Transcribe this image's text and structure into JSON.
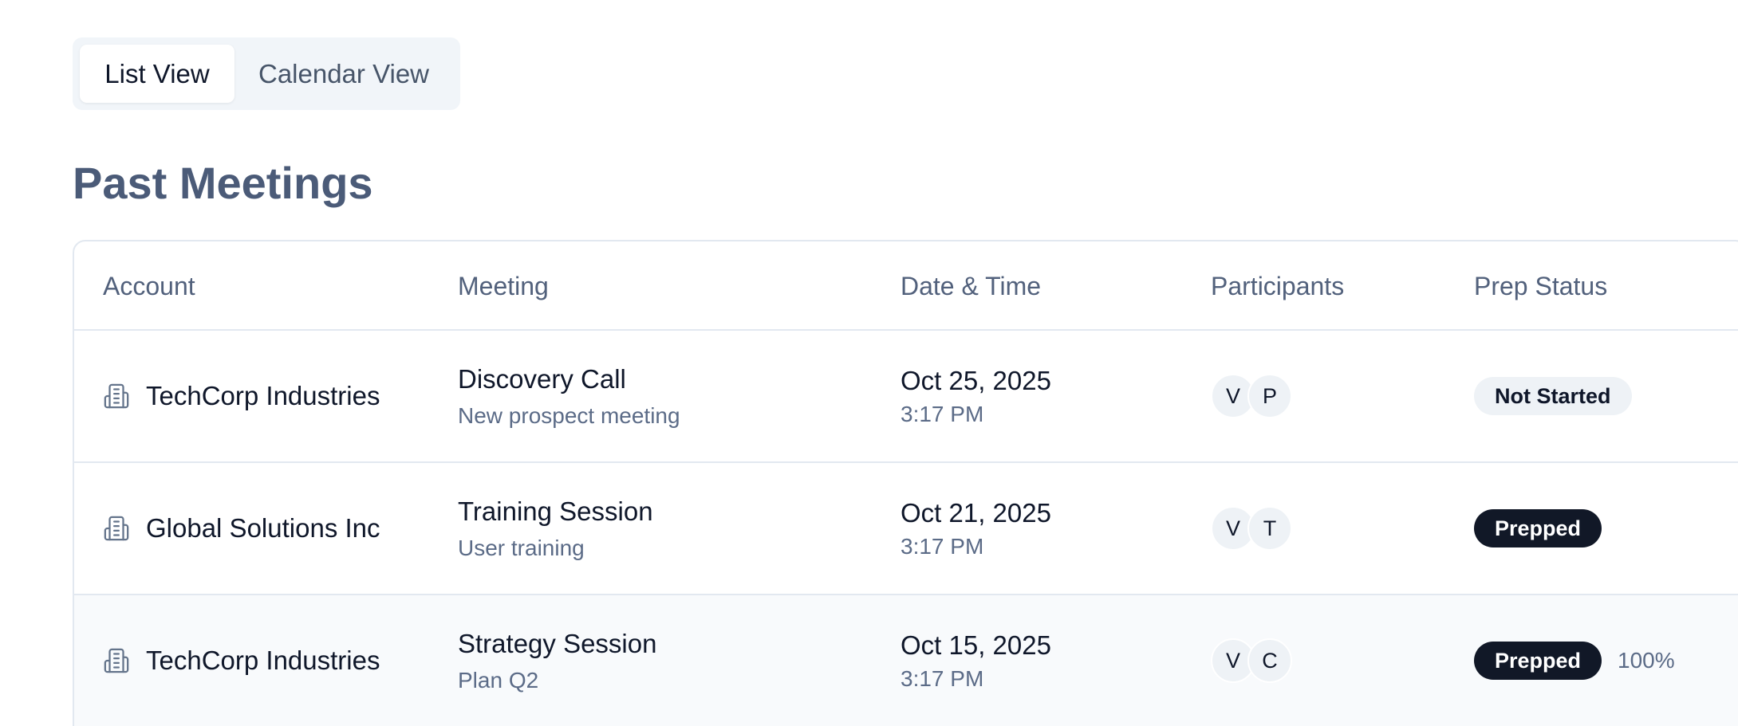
{
  "view_toggle": {
    "list_label": "List View",
    "calendar_label": "Calendar View"
  },
  "section_title": "Past Meetings",
  "table": {
    "headers": [
      "Account",
      "Meeting",
      "Date & Time",
      "Participants",
      "Prep Status"
    ],
    "rows": [
      {
        "account": "TechCorp Industries",
        "meeting_title": "Discovery Call",
        "meeting_subtitle": "New prospect meeting",
        "date": "Oct 25, 2025",
        "time": "3:17 PM",
        "participants": [
          "V",
          "P"
        ],
        "status": "Not Started",
        "percent": ""
      },
      {
        "account": "Global Solutions Inc",
        "meeting_title": "Training Session",
        "meeting_subtitle": "User training",
        "date": "Oct 21, 2025",
        "time": "3:17 PM",
        "participants": [
          "V",
          "T"
        ],
        "status": "Prepped",
        "percent": ""
      },
      {
        "account": "TechCorp Industries",
        "meeting_title": "Strategy Session",
        "meeting_subtitle": "Plan Q2",
        "date": "Oct 15, 2025",
        "time": "3:17 PM",
        "participants": [
          "V",
          "C"
        ],
        "status": "Prepped",
        "percent": "100%"
      }
    ]
  },
  "icons": {
    "account_icon": "building-icon"
  },
  "colors": {
    "title": "#4b5b78",
    "badge_dark": "#111827",
    "badge_light": "#eef2f6",
    "muted_text": "#5b6b87",
    "border": "#e2e8f0"
  }
}
